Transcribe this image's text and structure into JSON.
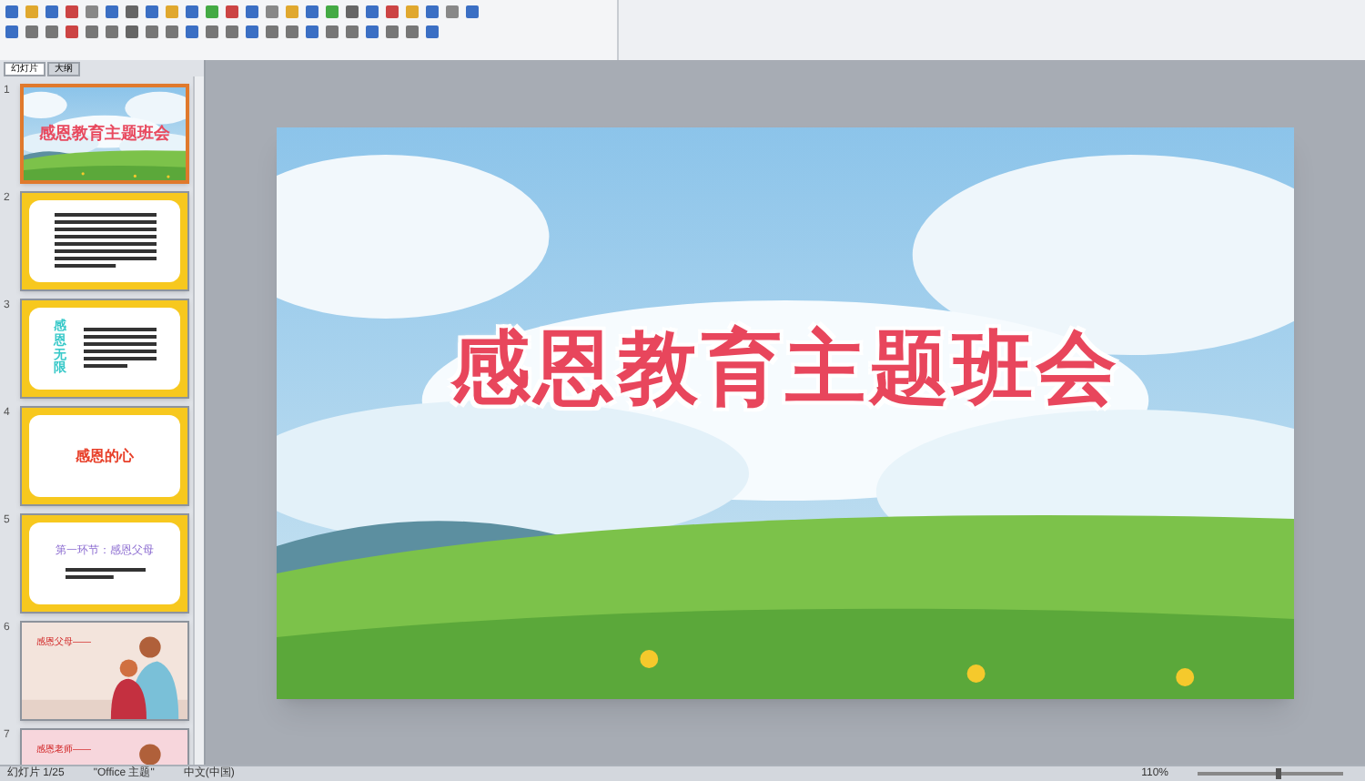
{
  "panel_tabs": [
    {
      "label": "幻灯片",
      "selected": true
    },
    {
      "label": "大纲",
      "selected": false
    }
  ],
  "slides": [
    {
      "number": "1",
      "kind": "title",
      "selected": true,
      "title": "感恩教育主题班会"
    },
    {
      "number": "2",
      "kind": "text",
      "selected": false
    },
    {
      "number": "3",
      "kind": "side",
      "selected": false,
      "title": "感恩无限"
    },
    {
      "number": "4",
      "kind": "heading",
      "selected": false,
      "title": "感恩的心"
    },
    {
      "number": "5",
      "kind": "section",
      "selected": false,
      "title": "第一环节：感恩父母"
    },
    {
      "number": "6",
      "selected": false,
      "title": "感恩父母——"
    },
    {
      "number": "7",
      "selected": false,
      "title": "感恩老师——"
    }
  ],
  "slide": {
    "title": "感恩教育主题班会"
  },
  "status_bar": {
    "slide_count": "幻灯片 1/25",
    "theme": "\"Office 主题\"",
    "language": "中文(中国)",
    "zoom": "110%",
    "zoom_slider": {
      "level": 0.55
    }
  }
}
